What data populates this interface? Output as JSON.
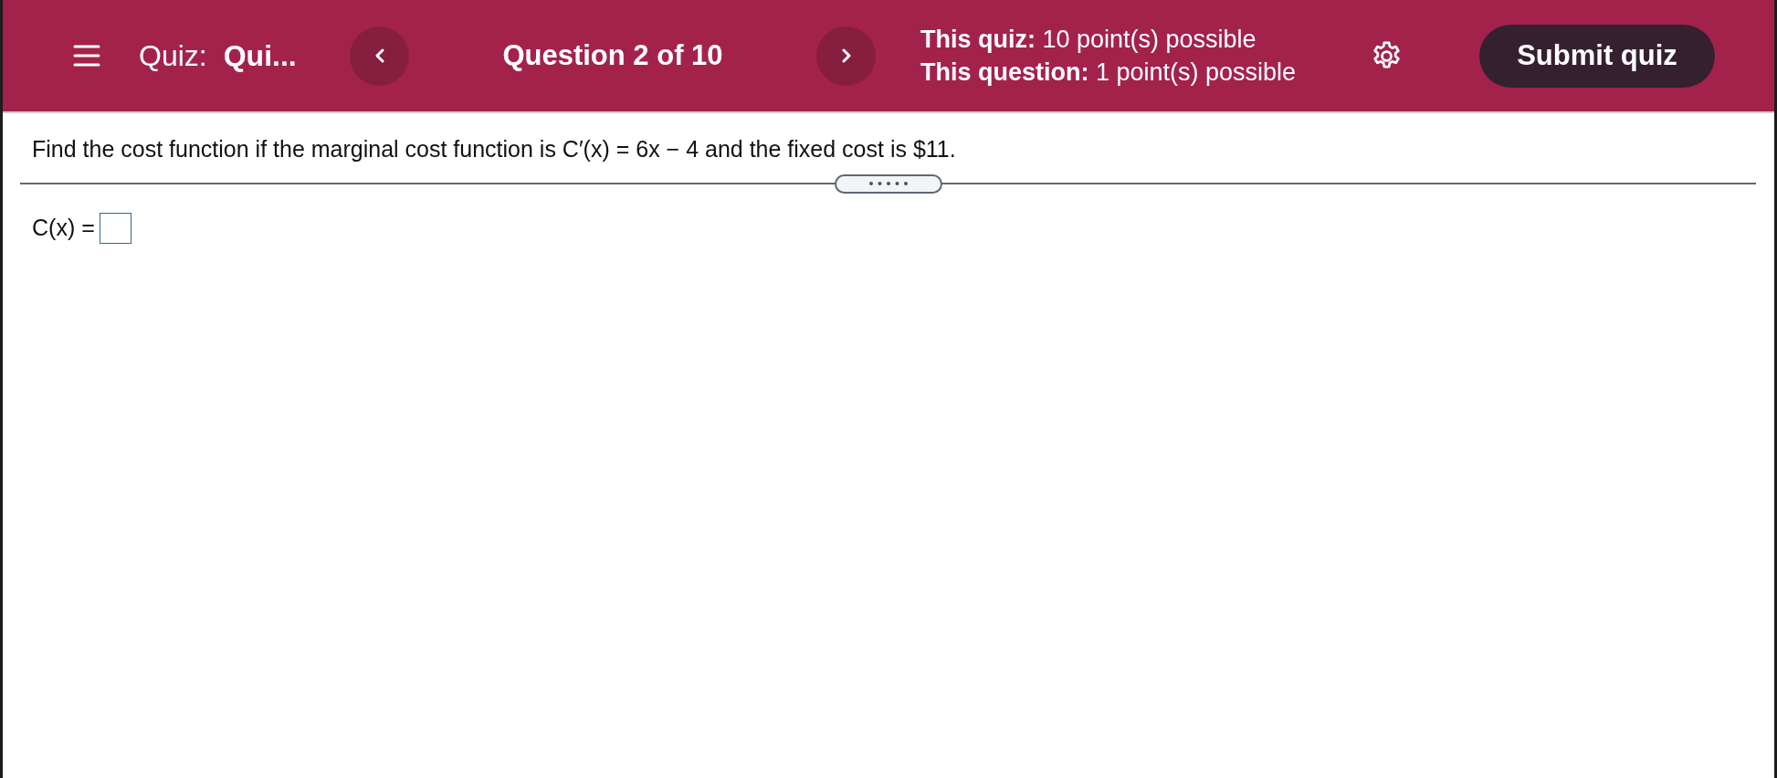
{
  "header": {
    "quiz_label": "Quiz:",
    "quiz_title": "Qui...",
    "question_counter": "Question 2 of 10",
    "points": [
      "**This quiz:** 10 point(s) possible",
      "**This question:** 1 point(s) possible"
    ],
    "submit_button": "Submit quiz"
  },
  "question": {
    "text": "Find the cost function if the marginal cost function is C′(x) = 6x − 4 and the fixed cost is $11.",
    "answer_label": "C(x) ="
  }
}
